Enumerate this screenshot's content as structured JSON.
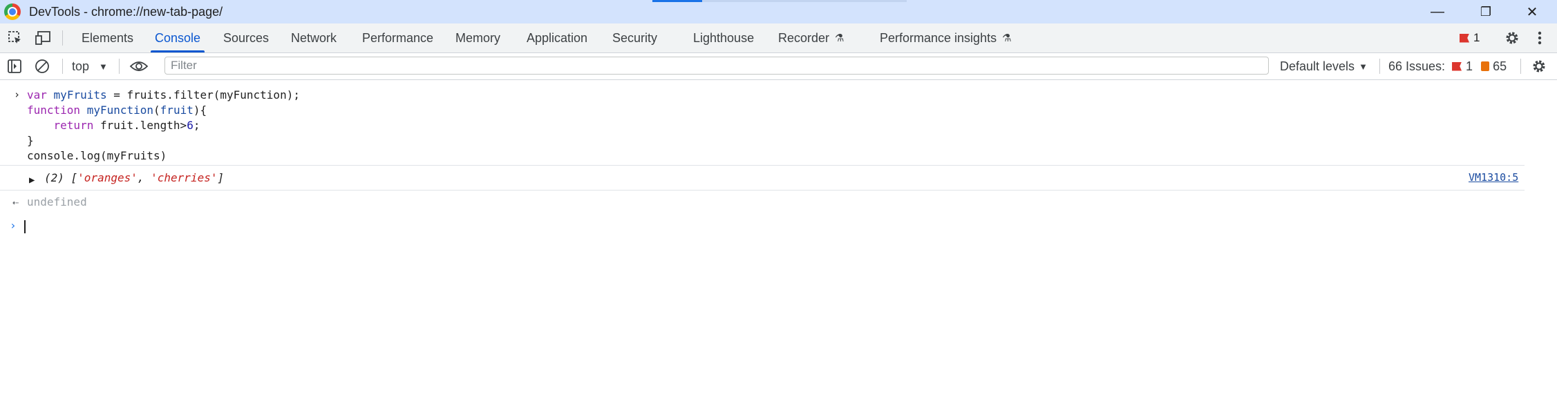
{
  "window": {
    "title": "DevTools - chrome://new-tab-page/",
    "minimize": "—",
    "restore": "❐",
    "close": "✕"
  },
  "tabs": [
    {
      "label": "Elements"
    },
    {
      "label": "Console"
    },
    {
      "label": "Sources"
    },
    {
      "label": "Network"
    },
    {
      "label": "Performance"
    },
    {
      "label": "Memory"
    },
    {
      "label": "Application"
    },
    {
      "label": "Security"
    },
    {
      "label": "Lighthouse"
    },
    {
      "label": "Recorder"
    },
    {
      "label": "Performance insights"
    }
  ],
  "active_tab": "Console",
  "error_count": "1",
  "console_toolbar": {
    "context": "top",
    "filter_placeholder": "Filter",
    "levels": "Default levels",
    "issues_label": "66 Issues:",
    "issues_errors": "1",
    "issues_warnings": "65"
  },
  "console": {
    "input_lines": [
      "var myFruits = fruits.filter(myFunction);",
      "function myFunction(fruit){",
      "    return fruit.length>6;",
      "}",
      "console.log(myFruits)"
    ],
    "result_count": "(2)",
    "result_items": [
      "'oranges'",
      "'cherries'"
    ],
    "result_link": "VM1310:5",
    "return_value": "undefined"
  },
  "colors": {
    "accent": "#0b57d0",
    "error": "#dc362e",
    "warning": "#e8710a",
    "titlebar": "#d3e3fd"
  }
}
